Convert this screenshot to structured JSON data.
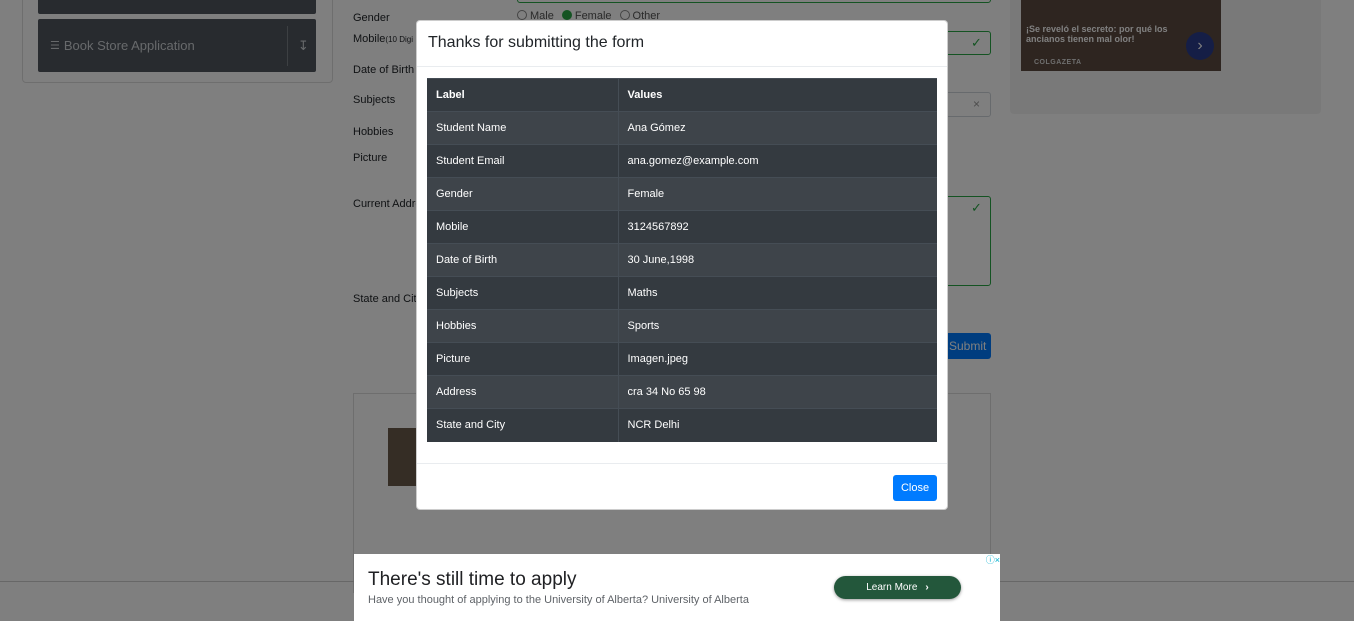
{
  "sidebar": {
    "book_store_label": "Book Store Application",
    "download_icon": "download-icon",
    "book_icon": "books-icon"
  },
  "background_form": {
    "gender_label": "Gender",
    "gender_options": [
      "Male",
      "Female",
      "Other"
    ],
    "mobile_label": "Mobile",
    "mobile_hint": "(10 Digi",
    "dob_label": "Date of Birth",
    "subjects_label": "Subjects",
    "hobbies_label": "Hobbies",
    "picture_label": "Picture",
    "address_label": "Current Addre",
    "state_city_label": "State and City",
    "submit_label": "Submit"
  },
  "side_ad": {
    "text": "¡Se reveló el secreto: por qué los ancianos tienen mal olor!",
    "brand": "COLGAZETA"
  },
  "modal": {
    "title": "Thanks for submitting the form",
    "headers": [
      "Label",
      "Values"
    ],
    "rows": [
      [
        "Student Name",
        "Ana Gómez"
      ],
      [
        "Student Email",
        "ana.gomez@example.com"
      ],
      [
        "Gender",
        "Female"
      ],
      [
        "Mobile",
        "3124567892"
      ],
      [
        "Date of Birth",
        "30 June,1998"
      ],
      [
        "Subjects",
        "Maths"
      ],
      [
        "Hobbies",
        "Sports"
      ],
      [
        "Picture",
        "Imagen.jpeg"
      ],
      [
        "Address",
        "cra 34 No 65 98"
      ],
      [
        "State and City",
        "NCR Delhi"
      ]
    ],
    "close_label": "Close"
  },
  "banner_ad": {
    "title": "There's still time to apply",
    "subtitle": "Have you thought of applying to the University of Alberta? University of Alberta",
    "button_label": "Learn More"
  },
  "colors": {
    "primary": "#007bff",
    "success": "#28a745",
    "table_dark": "#343a40",
    "banner_button": "#23573b"
  }
}
